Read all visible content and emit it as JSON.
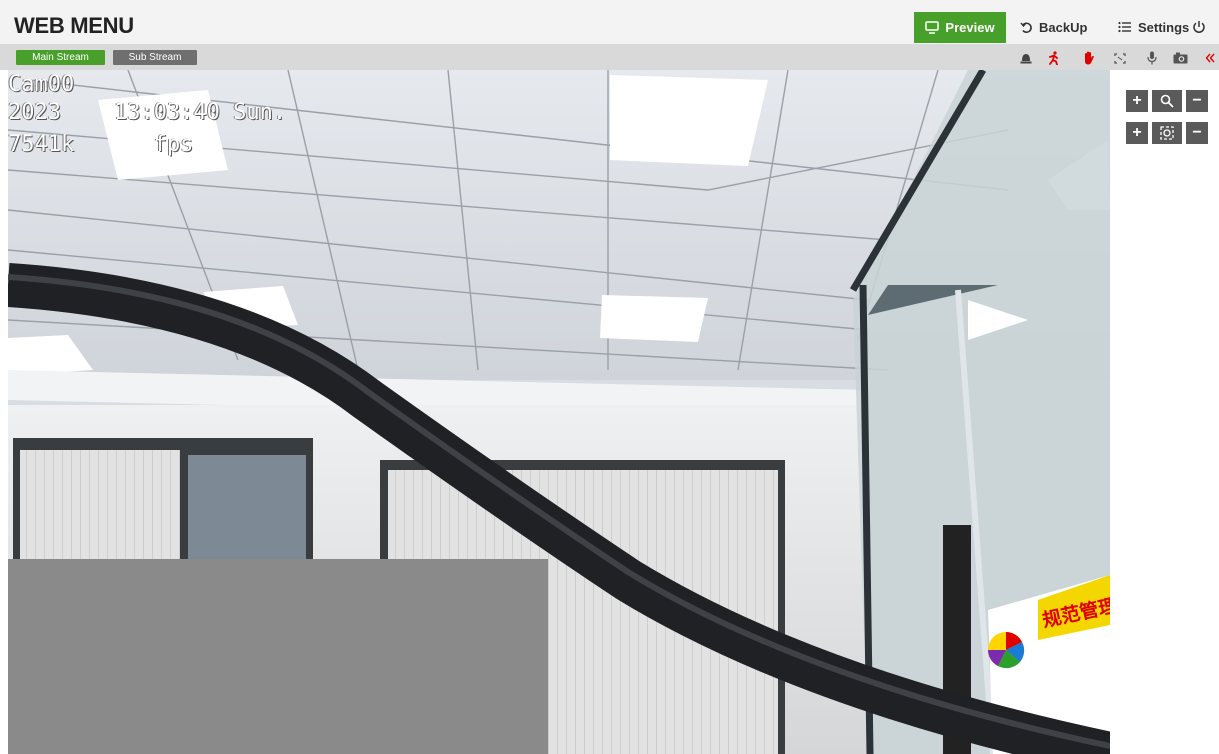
{
  "header": {
    "title": "WEB MENU",
    "nav": {
      "preview": "Preview",
      "backup": "BackUp",
      "settings": "Settings"
    }
  },
  "streams": {
    "main": "Main Stream",
    "sub": "Sub Stream",
    "active": "Main Stream"
  },
  "toolbar": {
    "icons": [
      "alarm-bell-icon",
      "motion-person-icon",
      "manual-alarm-hand-icon",
      "fullscreen-icon",
      "microphone-icon",
      "snapshot-camera-icon",
      "collapse-chevrons-icon"
    ]
  },
  "video": {
    "osd_camera": "Cam00",
    "osd_datetime": "2023    13:03:40 Sun.",
    "osd_bitrate": "7541k      fps",
    "sign_text": "规范管理"
  },
  "ptz": {
    "zoom_in": "+",
    "zoom_out": "−",
    "focus_in": "+",
    "focus_out": "−"
  },
  "colors": {
    "accent": "#47a02a",
    "alarm_red": "#e00000",
    "header_bg": "#f3f3f3",
    "stream_bar_bg": "#d9d9d9"
  }
}
